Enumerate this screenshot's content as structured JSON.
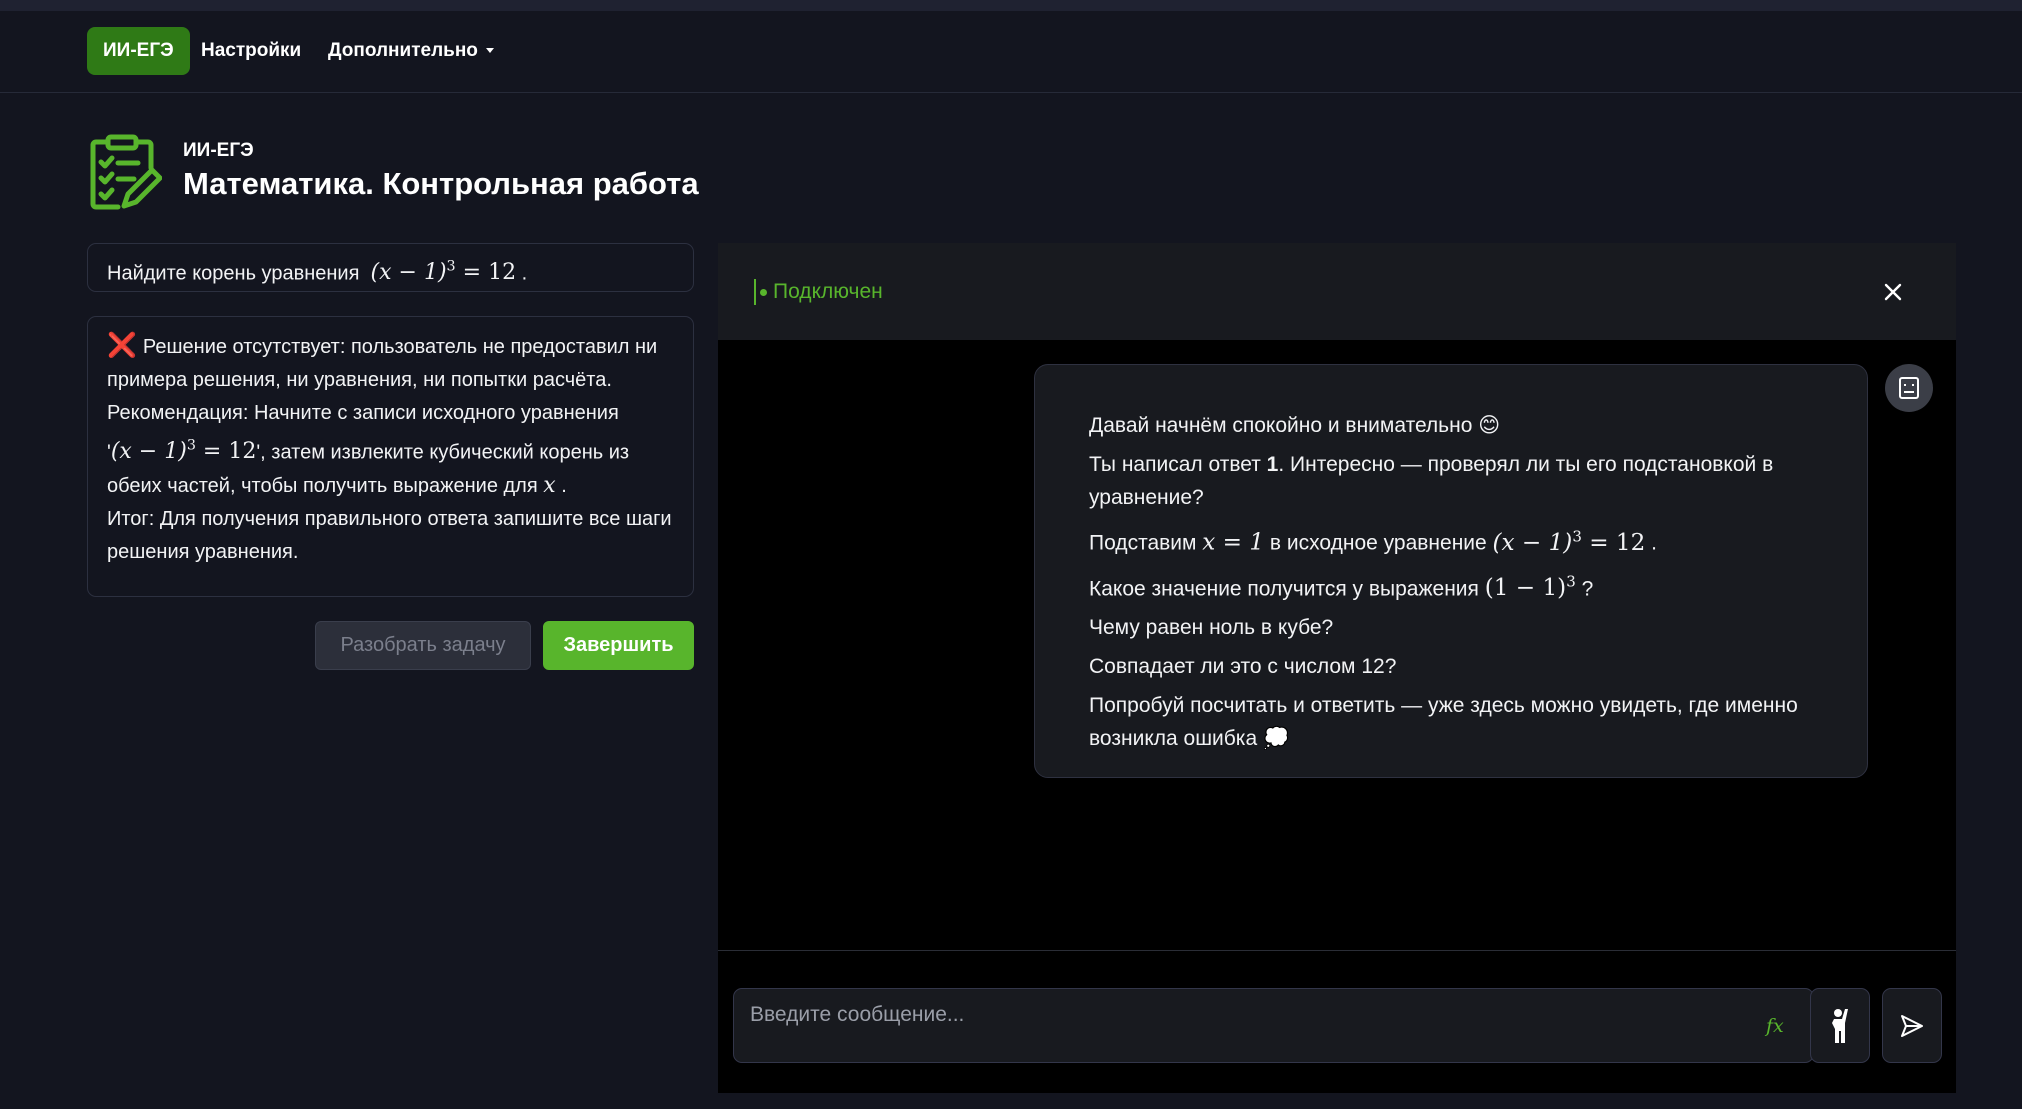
{
  "navbar": {
    "brand": "ИИ-ЕГЭ",
    "settings": "Настройки",
    "more": "Дополнительно"
  },
  "header": {
    "subtitle": "ИИ-ЕГЭ",
    "title": "Математика. Контрольная работа",
    "icon": "clipboard-checklist-icon"
  },
  "task": {
    "text": "Найдите корень уравнения",
    "equation_base": "(x − 1)",
    "equation_exp": "3",
    "equation_rhs": " = 12",
    "suffix": " ."
  },
  "feedback": {
    "icon": "❌",
    "line1": "Решение отсутствует: пользователь не предоставил ни примера решения, ни уравнения, ни попытки расчёта.",
    "line2_a": "Рекомендация: Начните с записи исходного уравнения '",
    "line2_eq_base": "(x − 1)",
    "line2_eq_exp": "3",
    "line2_eq_rhs": " = 12",
    "line2_b": "', затем извлеките кубический корень из обеих частей, чтобы получить выражение для",
    "line2_var": "x",
    "line2_end": " .",
    "line3": "Итог: Для получения правильного ответа запишите все шаги решения уравнения."
  },
  "buttons": {
    "analyze": "Разобрать задачу",
    "finish": "Завершить"
  },
  "chat": {
    "status": "Подключен",
    "messages": {
      "p1": "Давай начнём спокойно и внимательно 😊",
      "p2_a": "Ты написал ответ ",
      "p2_bold": "1",
      "p2_b": ". Интересно — проверял ли ты его подстановкой в уравнение?",
      "p3_a": "Подставим",
      "p3_m1": "x = 1",
      "p3_b": "в исходное уравнение",
      "p3_m2_base": "(x − 1)",
      "p3_m2_exp": "3",
      "p3_m2_rhs": " = 12",
      "p3_end": " .",
      "p4_a": "Какое значение получится у выражения",
      "p4_m_base": "(1 − 1)",
      "p4_m_exp": "3",
      "p4_end": " ?",
      "p5": "Чему равен ноль в кубе?",
      "p6": "Совпадает ли это с числом 12?",
      "p7": "Попробуй посчитать и ответить — уже здесь можно увидеть, где именно возникла ошибка 💭"
    },
    "input_placeholder": "Введите сообщение...",
    "fx_label": "fx"
  },
  "colors": {
    "accent": "#58b52c",
    "brand_bg": "#2f7a16",
    "error": "#ef4567",
    "background": "#13151f"
  }
}
